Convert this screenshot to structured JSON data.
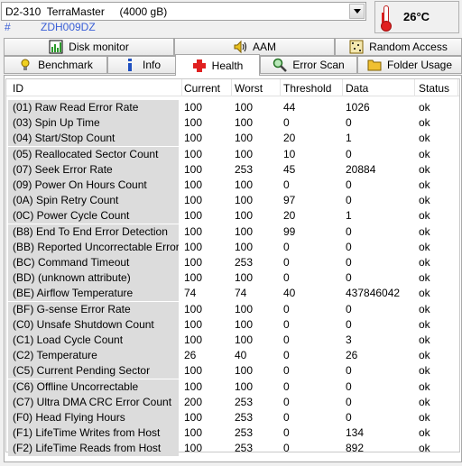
{
  "drive": {
    "selected": "D2-310  TerraMaster     (4000 gB)",
    "hash": "#",
    "serial": "ZDH009DZ",
    "temperature": "26°C"
  },
  "tabs_top": [
    {
      "label": "Disk monitor",
      "icon": "disk-monitor-icon"
    },
    {
      "label": "AAM",
      "icon": "speaker-icon"
    },
    {
      "label": "Random Access",
      "icon": "random-access-icon"
    }
  ],
  "tabs_bottom": [
    {
      "label": "Benchmark",
      "icon": "benchmark-icon"
    },
    {
      "label": "Info",
      "icon": "info-icon"
    },
    {
      "label": "Health",
      "icon": "health-cross-icon",
      "active": true
    },
    {
      "label": "Error Scan",
      "icon": "magnifier-icon"
    },
    {
      "label": "Folder Usage",
      "icon": "folder-icon"
    }
  ],
  "columns": [
    "ID",
    "Current",
    "Worst",
    "Threshold",
    "Data",
    "Status"
  ],
  "rows": [
    [
      "(01) Raw Read Error Rate",
      "100",
      "100",
      "44",
      "1026",
      "ok"
    ],
    [
      "(03) Spin Up Time",
      "100",
      "100",
      "0",
      "0",
      "ok"
    ],
    [
      "(04) Start/Stop Count",
      "100",
      "100",
      "20",
      "1",
      "ok"
    ],
    [
      "(05) Reallocated Sector Count",
      "100",
      "100",
      "10",
      "0",
      "ok"
    ],
    [
      "(07) Seek Error Rate",
      "100",
      "253",
      "45",
      "20884",
      "ok"
    ],
    [
      "(09) Power On Hours Count",
      "100",
      "100",
      "0",
      "0",
      "ok"
    ],
    [
      "(0A) Spin Retry Count",
      "100",
      "100",
      "97",
      "0",
      "ok"
    ],
    [
      "(0C) Power Cycle Count",
      "100",
      "100",
      "20",
      "1",
      "ok"
    ],
    [
      "(B8) End To End Error Detection",
      "100",
      "100",
      "99",
      "0",
      "ok"
    ],
    [
      "(BB) Reported Uncorrectable Errors",
      "100",
      "100",
      "0",
      "0",
      "ok"
    ],
    [
      "(BC) Command Timeout",
      "100",
      "253",
      "0",
      "0",
      "ok"
    ],
    [
      "(BD) (unknown attribute)",
      "100",
      "100",
      "0",
      "0",
      "ok"
    ],
    [
      "(BE) Airflow Temperature",
      "74",
      "74",
      "40",
      "437846042",
      "ok"
    ],
    [
      "(BF) G-sense Error Rate",
      "100",
      "100",
      "0",
      "0",
      "ok"
    ],
    [
      "(C0) Unsafe Shutdown Count",
      "100",
      "100",
      "0",
      "0",
      "ok"
    ],
    [
      "(C1) Load Cycle Count",
      "100",
      "100",
      "0",
      "3",
      "ok"
    ],
    [
      "(C2) Temperature",
      "26",
      "40",
      "0",
      "26",
      "ok"
    ],
    [
      "(C5) Current Pending Sector",
      "100",
      "100",
      "0",
      "0",
      "ok"
    ],
    [
      "(C6) Offline Uncorrectable",
      "100",
      "100",
      "0",
      "0",
      "ok"
    ],
    [
      "(C7) Ultra DMA CRC Error Count",
      "200",
      "253",
      "0",
      "0",
      "ok"
    ],
    [
      "(F0) Head Flying Hours",
      "100",
      "253",
      "0",
      "0",
      "ok"
    ],
    [
      "(F1) LifeTime Writes from Host",
      "100",
      "253",
      "0",
      "134",
      "ok"
    ],
    [
      "(F2) LifeTime Reads from Host",
      "100",
      "253",
      "0",
      "892",
      "ok"
    ]
  ]
}
